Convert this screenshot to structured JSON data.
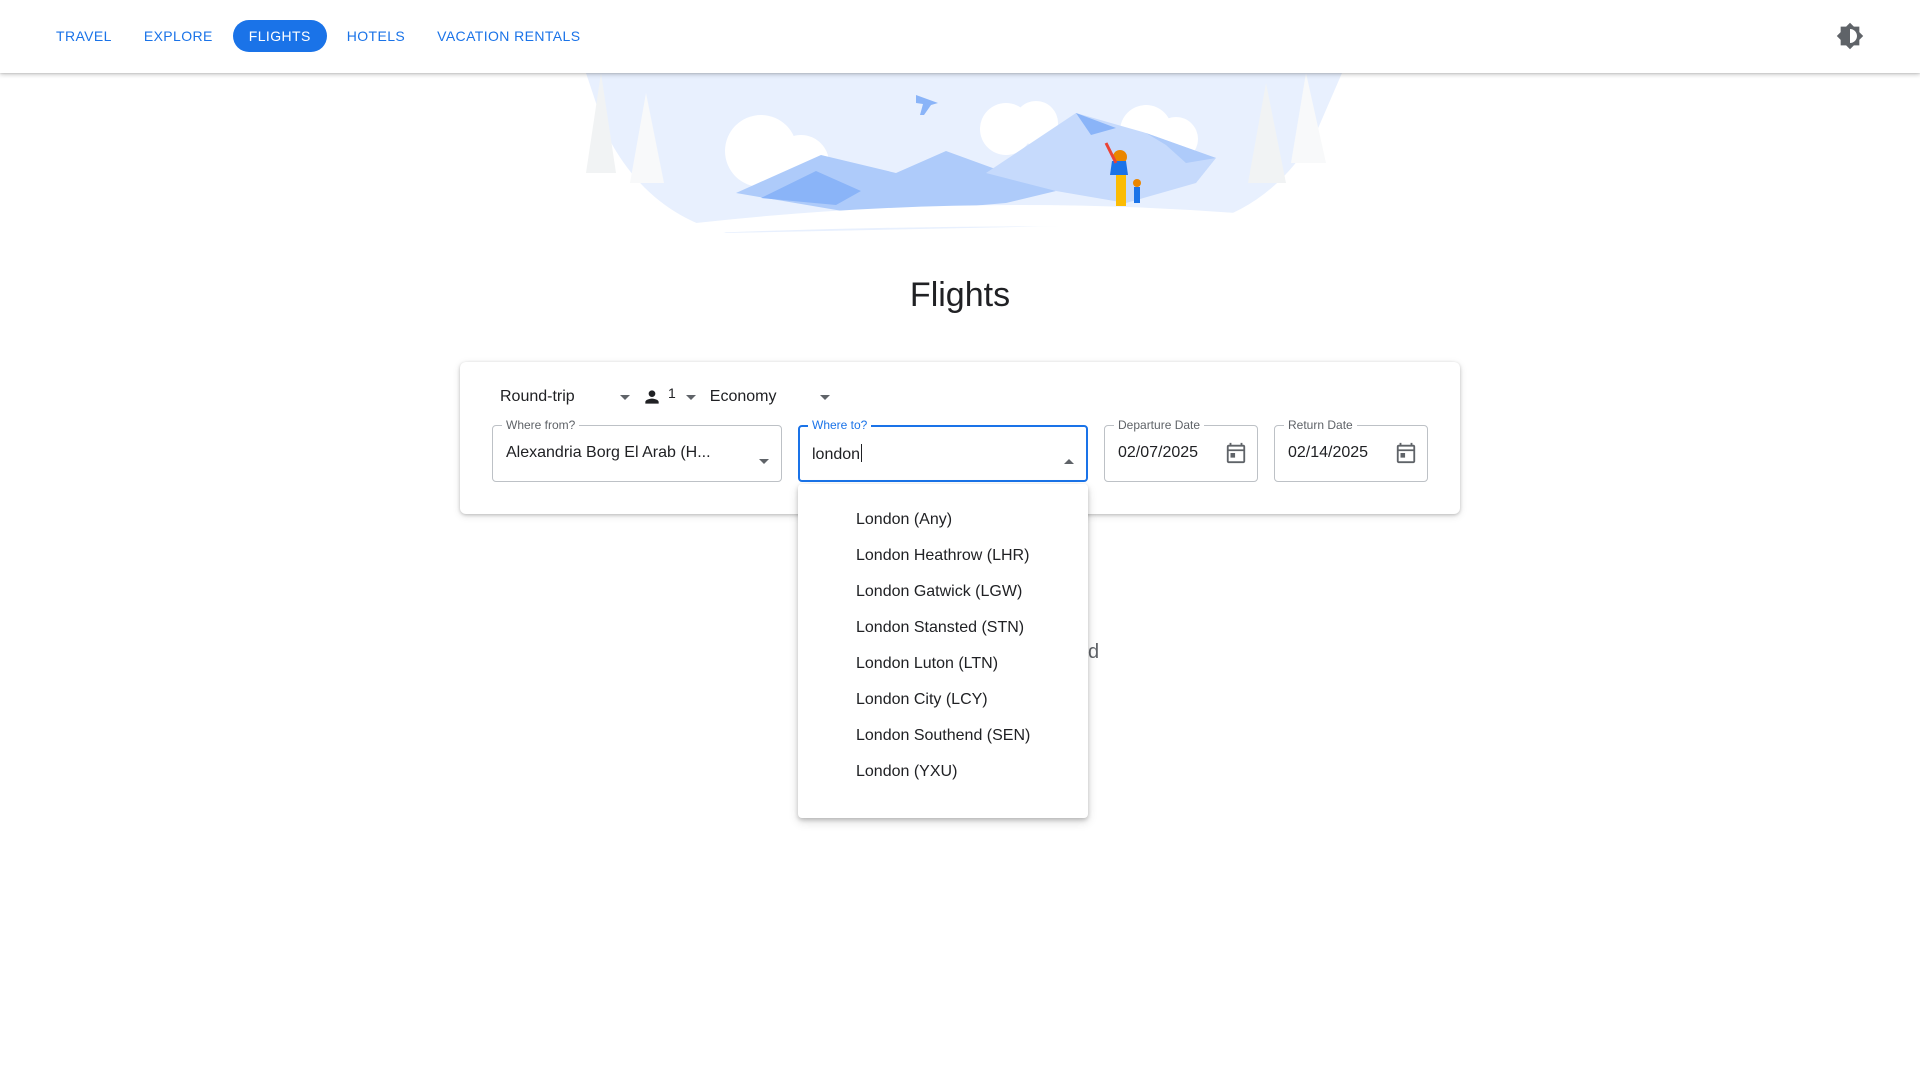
{
  "nav": {
    "items": [
      {
        "label": "TRAVEL",
        "active": false
      },
      {
        "label": "EXPLORE",
        "active": false
      },
      {
        "label": "FLIGHTS",
        "active": true
      },
      {
        "label": "HOTELS",
        "active": false
      },
      {
        "label": "VACATION RENTALS",
        "active": false
      }
    ],
    "theme_icon": "brightness-icon"
  },
  "page": {
    "title": "Flights"
  },
  "search": {
    "trip_type": "Round-trip",
    "passengers": "1",
    "cabin_class": "Economy",
    "from": {
      "label": "Where from?",
      "value": "Alexandria Borg El Arab (H..."
    },
    "to": {
      "label": "Where to?",
      "value": "london"
    },
    "departure": {
      "label": "Departure Date",
      "value": "02/07/2025"
    },
    "return": {
      "label": "Return Date",
      "value": "02/14/2025"
    }
  },
  "suggestions": [
    "London (Any)",
    "London Heathrow (LHR)",
    "London Gatwick (LGW)",
    "London Stansted (STN)",
    "London Luton (LTN)",
    "London City (LCY)",
    "London Southend (SEN)",
    "London (YXU)"
  ],
  "background_partial_text": "d",
  "colors": {
    "accent": "#1a73e8",
    "hero_blue": "#aecbfa",
    "hero_light": "#e8f0fe"
  }
}
